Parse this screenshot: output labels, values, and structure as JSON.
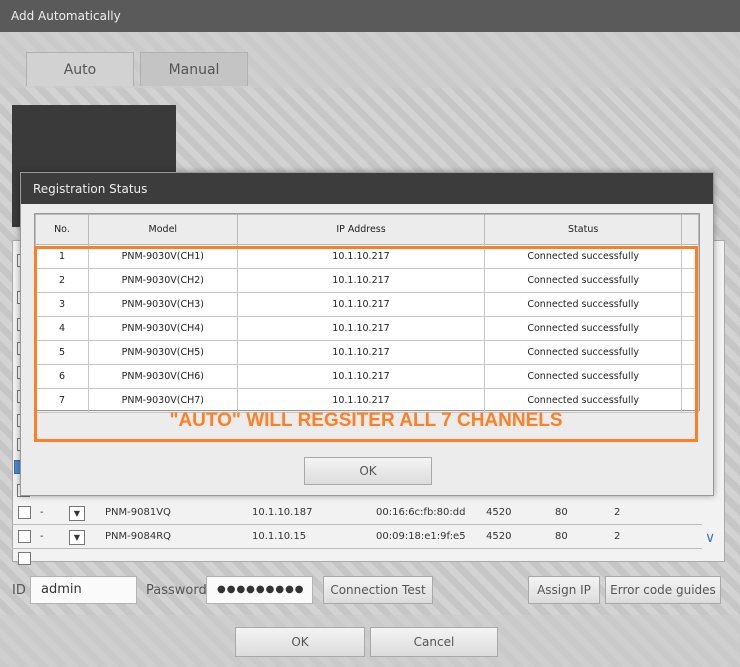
{
  "window": {
    "title": "Add Automatically"
  },
  "tabs": [
    {
      "label": "Auto"
    },
    {
      "label": "Manual"
    }
  ],
  "background_table": {
    "rows": [
      {
        "dash": "-",
        "model": "PNM-9081VQ",
        "ip": "10.1.10.187",
        "mac": "00:16:6c:fb:80:dd",
        "port": "4520",
        "http": "80",
        "ch": "2"
      },
      {
        "dash": "-",
        "model": "PNM-9084RQ",
        "ip": "10.1.10.15",
        "mac": "00:09:18:e1:9f:e5",
        "port": "4520",
        "http": "80",
        "ch": "2"
      }
    ]
  },
  "form": {
    "id_label": "ID",
    "id_value": "admin",
    "password_label": "Password",
    "password_value": "●●●●●●●●●",
    "connection_test": "Connection Test",
    "assign_ip": "Assign IP",
    "error_code_guides": "Error code guides"
  },
  "footer": {
    "ok": "OK",
    "cancel": "Cancel"
  },
  "dialog": {
    "title": "Registration Status",
    "columns": [
      "No.",
      "Model",
      "IP Address",
      "Status"
    ],
    "rows": [
      {
        "no": "1",
        "model": "PNM-9030V(CH1)",
        "ip": "10.1.10.217",
        "status": "Connected successfully"
      },
      {
        "no": "2",
        "model": "PNM-9030V(CH2)",
        "ip": "10.1.10.217",
        "status": "Connected successfully"
      },
      {
        "no": "3",
        "model": "PNM-9030V(CH3)",
        "ip": "10.1.10.217",
        "status": "Connected successfully"
      },
      {
        "no": "4",
        "model": "PNM-9030V(CH4)",
        "ip": "10.1.10.217",
        "status": "Connected successfully"
      },
      {
        "no": "5",
        "model": "PNM-9030V(CH5)",
        "ip": "10.1.10.217",
        "status": "Connected successfully"
      },
      {
        "no": "6",
        "model": "PNM-9030V(CH6)",
        "ip": "10.1.10.217",
        "status": "Connected successfully"
      },
      {
        "no": "7",
        "model": "PNM-9030V(CH7)",
        "ip": "10.1.10.217",
        "status": "Connected successfully"
      }
    ],
    "ok": "OK"
  },
  "annotation": {
    "text": "\"AUTO\" WILL REGSITER ALL 7 CHANNELS",
    "color": "#ff7f24"
  }
}
